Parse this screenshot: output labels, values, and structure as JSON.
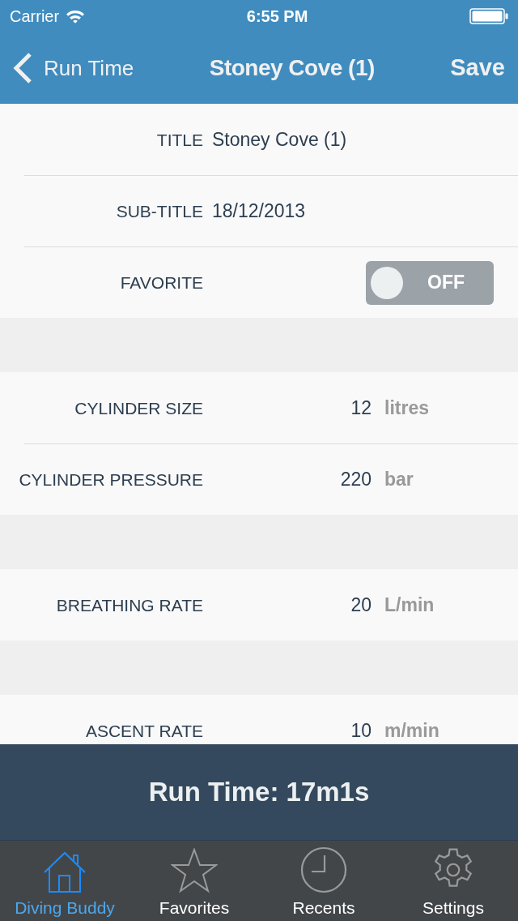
{
  "status_bar": {
    "carrier": "Carrier",
    "time": "6:55 PM"
  },
  "nav_bar": {
    "back": "Run Time",
    "title": "Stoney Cove (1)",
    "action": "Save"
  },
  "sections": [
    {
      "rows": [
        {
          "kind": "text",
          "label": "TITLE",
          "value": "Stoney Cove (1)"
        },
        {
          "kind": "text",
          "label": "SUB-TITLE",
          "value": "18/12/2013"
        },
        {
          "kind": "toggle",
          "label": "FAVORITE",
          "on": false,
          "state_label": "OFF"
        }
      ]
    },
    {
      "rows": [
        {
          "kind": "measure",
          "label": "CYLINDER SIZE",
          "value": "12",
          "unit": "litres"
        },
        {
          "kind": "measure",
          "label": "CYLINDER PRESSURE",
          "value": "220",
          "unit": "bar"
        }
      ]
    },
    {
      "rows": [
        {
          "kind": "measure",
          "label": "BREATHING RATE",
          "value": "20",
          "unit": "L/min"
        }
      ]
    },
    {
      "rows": [
        {
          "kind": "measure",
          "label": "ASCENT RATE",
          "value": "10",
          "unit": "m/min"
        }
      ]
    }
  ],
  "run_time_bar": {
    "text": "Run Time: 17m1s"
  },
  "tab_bar": {
    "tabs": [
      {
        "label": "Diving Buddy",
        "selected": true
      },
      {
        "label": "Favorites",
        "selected": false
      },
      {
        "label": "Recents",
        "selected": false
      },
      {
        "label": "Settings",
        "selected": false
      }
    ]
  }
}
